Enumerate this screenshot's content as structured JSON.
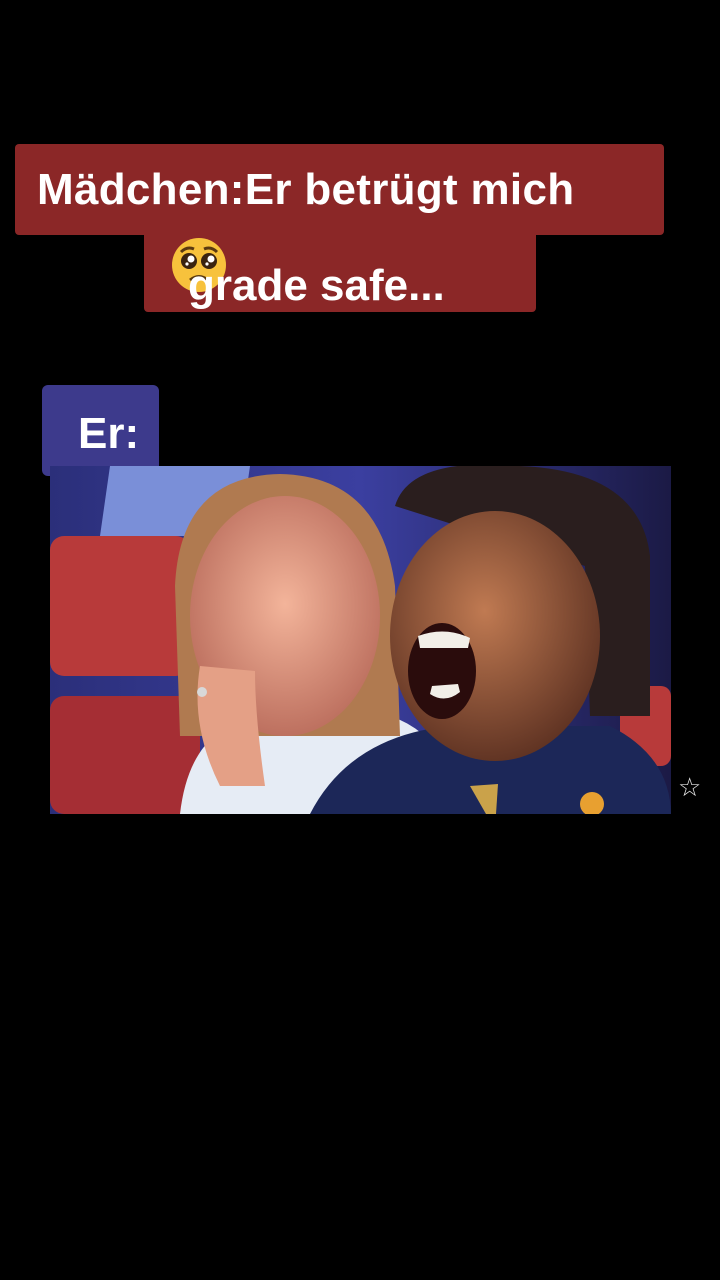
{
  "caption": {
    "line1": "Mädchen:Er betrügt mich",
    "line2": "grade safe...",
    "emoji": "pleading-face-emoji",
    "background": "#8b2727"
  },
  "label": {
    "text": "Er:",
    "background": "#3d3a8c"
  },
  "photo": {
    "icon": "crowd-reaction-photo"
  },
  "corner_icon": "star-icon"
}
